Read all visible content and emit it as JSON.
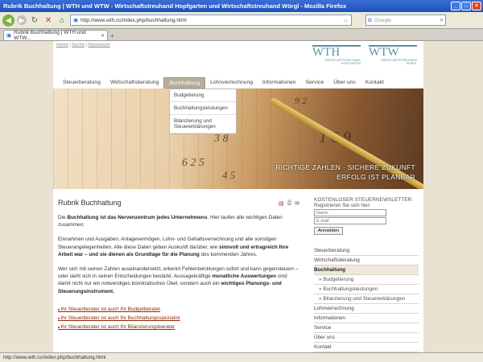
{
  "window": {
    "title": "Rubrik Buchhaltung | WTH und WTW - Wirtschaftstreuhand Hopfgarten und Wirtschaftstreuhand Wörgl - Mozilla Firefox"
  },
  "browser": {
    "url": "http://www.wth.cc/index.php/buchhaltung.html",
    "search_placeholder": "Google",
    "tab_title": "Rubrik Buchhaltung | WTH und WTW...",
    "status_text": "http://www.wth.cc/index.php/buchhaltung.html"
  },
  "header": {
    "links": [
      "Home",
      "Suche",
      "Impressum"
    ],
    "logo1": {
      "big": "WTH",
      "small1": "WIRTSCHAFTSTREUHAND",
      "small2": "HOPFGARTEN"
    },
    "logo2": {
      "big": "WTW",
      "small1": "WIRTSCHAFTSTREUHAND",
      "small2": "WÖRGL"
    }
  },
  "menu": {
    "items": [
      "Steuerberatung",
      "Wirtschaftsberatung",
      "Buchhaltung",
      "Lohnverrechnung",
      "Informationen",
      "Service",
      "Über uns",
      "Kontakt"
    ],
    "active_index": 2
  },
  "dropdown": {
    "items": [
      "Budgetierung",
      "Buchhaltungsleistungen",
      "Bilanzierung und Steuererklärungen"
    ]
  },
  "banner": {
    "slogan_line1": "RICHTIGE ZAHLEN · SICHERE ZUKUNFT",
    "slogan_line2": "ERFOLG IST PLANBAR"
  },
  "content": {
    "heading": "Rubrik Buchhaltung",
    "p1_a": "Die ",
    "p1_b": "Buchhaltung ist das Nervenzentrum jedes Unternehmens",
    "p1_c": ". Hier laufen alle wichtigen Daten zusammen:",
    "p2_a": "Einnahmen und Ausgaben, Anlagevermögen, Lohn- und Gehaltsverrechnung und alle sonstigen Steuerangelegenheiten. Alle diese Daten geben Auskunft darüber, wie ",
    "p2_b": "sinnvoll und ertragreich Ihre Arbeit war – und sie dienen als Grundlage für die Planung",
    "p2_c": " des kommenden Jahres.",
    "p3_a": "Wer sich mit seinen Zahlen auseinandersetzt, erkennt Fehlentwicklungen sofort und kann gegensteuern – oder sieht sich in seinen Entscheidungen bestärkt. Aussagekräftige ",
    "p3_b": "monatliche Auswertungen",
    "p3_c": " sind damit nicht nur ein notwendiges bürokratisches Übel, sondern auch ein ",
    "p3_d": "wichtiges Planungs- und Steuerungsinstrument.",
    "links": [
      "Ihr Steuerberater ist auch Ihr Budgetberater",
      "Ihr Steuerberater ist auch Ihr Buchhaltungsspezialist",
      "Ihr Steuerberater ist auch Ihr Bilanzierungsberater"
    ]
  },
  "sidebar": {
    "newsletter_title": "KOSTENLOSER STEUERNEWSLETTER",
    "newsletter_sub": "Registrieren Sie sich hier:",
    "name_placeholder": "Name",
    "email_placeholder": "E-mail",
    "submit_label": "Anmelden",
    "nav": [
      {
        "label": "Steuerberatung",
        "type": "main"
      },
      {
        "label": "Wirtschaftsberatung",
        "type": "main"
      },
      {
        "label": "Buchhaltung",
        "type": "active"
      },
      {
        "label": "Budgetierung",
        "type": "sub"
      },
      {
        "label": "Buchhaltungsleistungen",
        "type": "sub"
      },
      {
        "label": "Bilanzierung und Steuererklärungen",
        "type": "sub"
      },
      {
        "label": "Lohnverrechnung",
        "type": "main"
      },
      {
        "label": "Informationen",
        "type": "main"
      },
      {
        "label": "Service",
        "type": "main"
      },
      {
        "label": "Über uns",
        "type": "main"
      },
      {
        "label": "Kontakt",
        "type": "main"
      }
    ]
  }
}
